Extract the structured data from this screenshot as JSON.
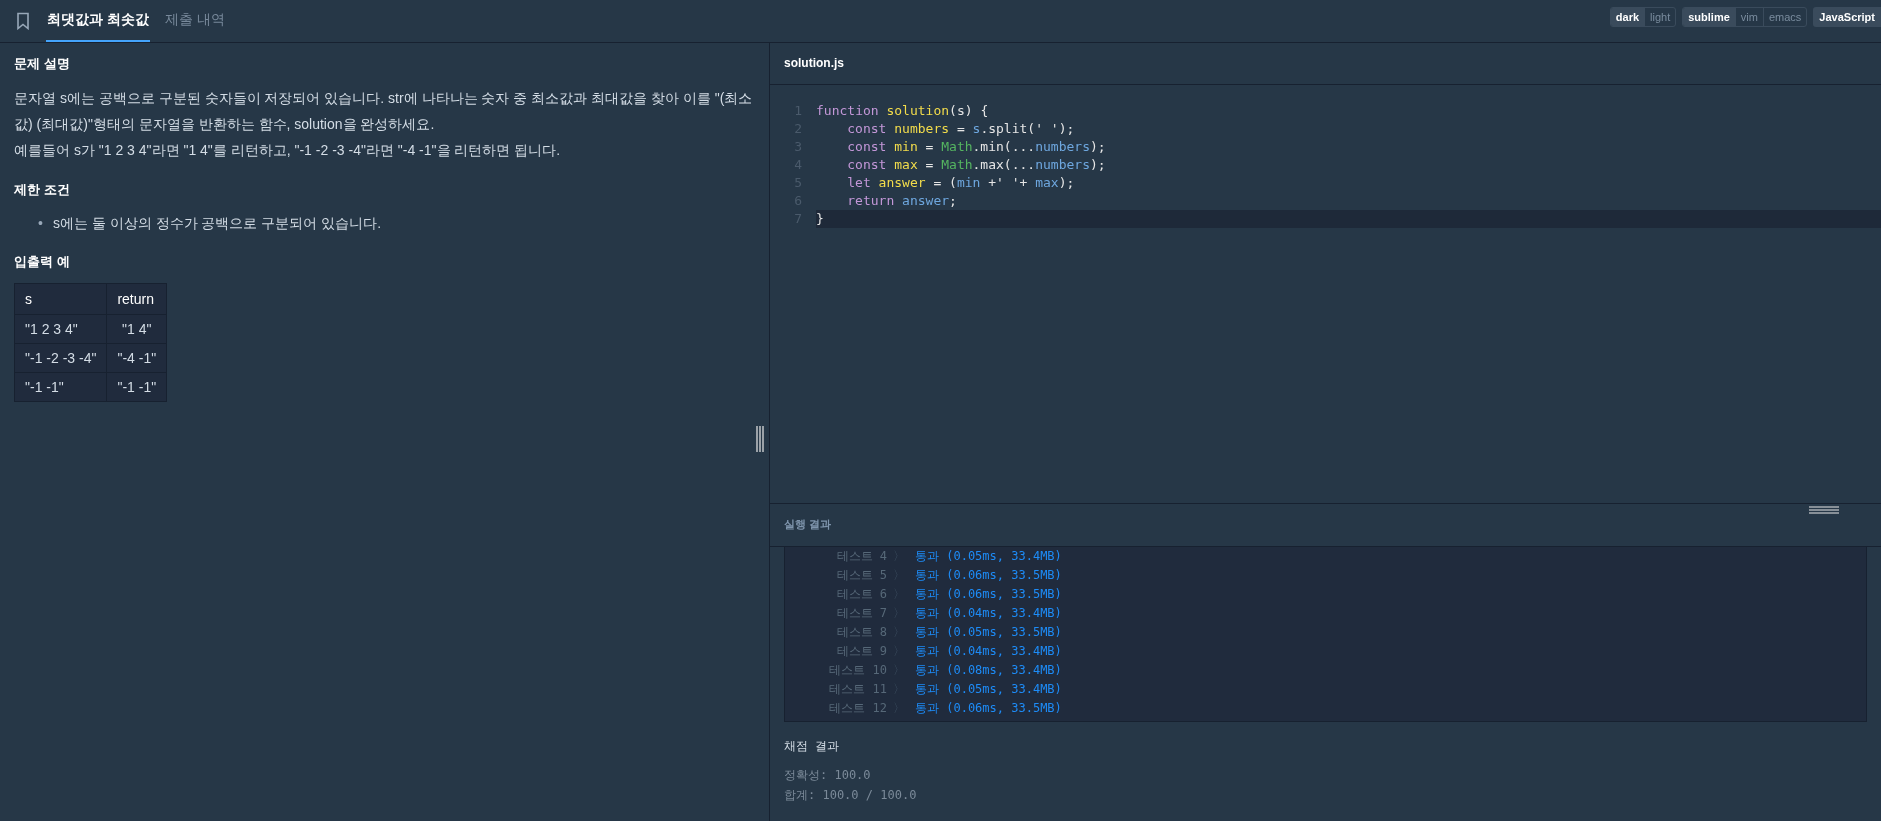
{
  "tabs": [
    {
      "label": "최댓값과 최솟값",
      "selected": true
    },
    {
      "label": "제출 내역",
      "selected": false
    }
  ],
  "toolbar": {
    "theme": [
      {
        "label": "dark",
        "selected": true
      },
      {
        "label": "light",
        "selected": false
      }
    ],
    "keymap": [
      {
        "label": "sublime",
        "selected": true
      },
      {
        "label": "vim",
        "selected": false
      },
      {
        "label": "emacs",
        "selected": false
      }
    ],
    "language": "JavaScript"
  },
  "problem": {
    "sections": [
      {
        "title": "문제 설명",
        "kind": "paragraphs",
        "lines": [
          "문자열 s에는 공백으로 구분된 숫자들이 저장되어 있습니다. str에 나타나는 숫자 중 최소값과 최대값을 찾아 이를 \"(최소값) (최대값)\"형태의 문자열을 반환하는 함수, solution을 완성하세요.",
          "예를들어 s가 \"1 2 3 4\"라면 \"1 4\"를 리턴하고, \"-1 -2 -3 -4\"라면 \"-4 -1\"을 리턴하면 됩니다."
        ]
      },
      {
        "title": "제한 조건",
        "kind": "bullets",
        "marker": "•",
        "lines": [
          "s에는 둘 이상의 정수가 공백으로 구분되어 있습니다."
        ]
      },
      {
        "title": "입출력 예",
        "kind": "table",
        "columns": [
          "s",
          "return"
        ],
        "rows": [
          [
            "\"1 2 3 4\"",
            "\"1 4\""
          ],
          [
            "\"-1 -2 -3 -4\"",
            "\"-4 -1\""
          ],
          [
            "\"-1 -1\"",
            "\"-1 -1\""
          ]
        ]
      }
    ]
  },
  "editor": {
    "filename": "solution.js",
    "lines": [
      {
        "number": "1",
        "active": false,
        "indented": false,
        "tokens": [
          {
            "text": "function ",
            "kind": "keyword"
          },
          {
            "text": "solution",
            "kind": "def"
          },
          {
            "text": "(s) {",
            "kind": "plain"
          }
        ]
      },
      {
        "number": "2",
        "active": false,
        "indented": true,
        "tokens": [
          {
            "text": "const ",
            "kind": "keyword"
          },
          {
            "text": "numbers",
            "kind": "def"
          },
          {
            "text": " = ",
            "kind": "plain"
          },
          {
            "text": "s",
            "kind": "var"
          },
          {
            "text": ".split(' ');",
            "kind": "plain"
          }
        ]
      },
      {
        "number": "3",
        "active": false,
        "indented": true,
        "tokens": [
          {
            "text": "const ",
            "kind": "keyword"
          },
          {
            "text": "min",
            "kind": "def"
          },
          {
            "text": " = ",
            "kind": "plain"
          },
          {
            "text": "Math",
            "kind": "builtin"
          },
          {
            "text": ".min(...",
            "kind": "plain"
          },
          {
            "text": "numbers",
            "kind": "var"
          },
          {
            "text": ");",
            "kind": "plain"
          }
        ]
      },
      {
        "number": "4",
        "active": false,
        "indented": true,
        "tokens": [
          {
            "text": "const ",
            "kind": "keyword"
          },
          {
            "text": "max",
            "kind": "def"
          },
          {
            "text": " = ",
            "kind": "plain"
          },
          {
            "text": "Math",
            "kind": "builtin"
          },
          {
            "text": ".max(...",
            "kind": "plain"
          },
          {
            "text": "numbers",
            "kind": "var"
          },
          {
            "text": ");",
            "kind": "plain"
          }
        ]
      },
      {
        "number": "5",
        "active": false,
        "indented": true,
        "tokens": [
          {
            "text": "let ",
            "kind": "keyword"
          },
          {
            "text": "answer",
            "kind": "def"
          },
          {
            "text": " = (",
            "kind": "plain"
          },
          {
            "text": "min",
            "kind": "var"
          },
          {
            "text": " +' '+ ",
            "kind": "plain"
          },
          {
            "text": "max",
            "kind": "var"
          },
          {
            "text": ");",
            "kind": "plain"
          }
        ]
      },
      {
        "number": "6",
        "active": false,
        "indented": true,
        "tokens": [
          {
            "text": "return ",
            "kind": "keyword"
          },
          {
            "text": "answer",
            "kind": "var"
          },
          {
            "text": ";",
            "kind": "plain"
          }
        ]
      },
      {
        "number": "7",
        "active": true,
        "indented": false,
        "tokens": [
          {
            "text": "}",
            "kind": "plain"
          }
        ]
      }
    ]
  },
  "results": {
    "title": "실행 결과",
    "tests": [
      {
        "label": "테스트 4",
        "arrow": "〉",
        "result": "통과 (0.05ms, 33.4MB)"
      },
      {
        "label": "테스트 5",
        "arrow": "〉",
        "result": "통과 (0.06ms, 33.5MB)"
      },
      {
        "label": "테스트 6",
        "arrow": "〉",
        "result": "통과 (0.06ms, 33.5MB)"
      },
      {
        "label": "테스트 7",
        "arrow": "〉",
        "result": "통과 (0.04ms, 33.4MB)"
      },
      {
        "label": "테스트 8",
        "arrow": "〉",
        "result": "통과 (0.05ms, 33.5MB)"
      },
      {
        "label": "테스트 9",
        "arrow": "〉",
        "result": "통과 (0.04ms, 33.4MB)"
      },
      {
        "label": "테스트 10",
        "arrow": "〉",
        "result": "통과 (0.08ms, 33.4MB)"
      },
      {
        "label": "테스트 11",
        "arrow": "〉",
        "result": "통과 (0.05ms, 33.4MB)"
      },
      {
        "label": "테스트 12",
        "arrow": "〉",
        "result": "통과 (0.06ms, 33.5MB)"
      }
    ],
    "grading": {
      "title": "채점 결과",
      "lines": [
        "정확성: 100.0",
        "합계: 100.0 / 100.0"
      ]
    }
  }
}
